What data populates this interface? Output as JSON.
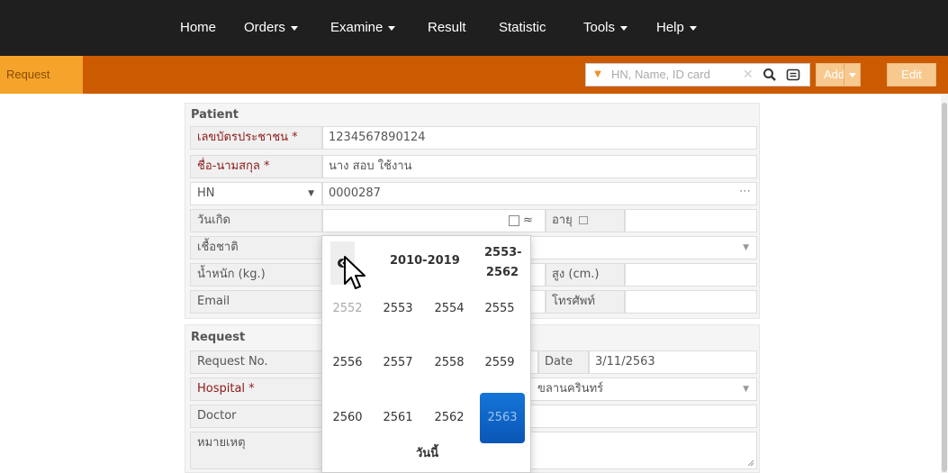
{
  "nav": {
    "items": [
      {
        "label": "Home"
      },
      {
        "label": "Orders"
      },
      {
        "label": "Examine"
      },
      {
        "label": "Result"
      },
      {
        "label": "Statistic"
      },
      {
        "label": "Tools"
      },
      {
        "label": "Help"
      }
    ]
  },
  "toolbar": {
    "tab_label": "Request",
    "search_placeholder": "HN, Name, ID card",
    "add_label": "Add",
    "edit_label": "Edit"
  },
  "patient": {
    "title": "Patient",
    "id_label": "เลขบัตรประชาชน *",
    "id_value": "1234567890124",
    "name_label": "ชื่อ-นามสกุล *",
    "name_value": "นาง สอบ ใช้งาน",
    "hn_label": "HN",
    "hn_value": "0000287",
    "dob_label": "วันเกิด",
    "approx_label": "≈",
    "age_label": "อายุ",
    "nation_label": "เชื้อชาติ",
    "weight_label": "น้ำหนัก (kg.)",
    "height_label": "สูง (cm.)",
    "email_label": "Email",
    "phone_label": "โทรศัพท์"
  },
  "request": {
    "title": "Request",
    "reqno_label": "Request No.",
    "date_label": "Date",
    "date_value": "3/11/2563",
    "hospital_label": "Hospital *",
    "hospital_value": "ขลานครินทร์",
    "doctor_label": "Doctor",
    "note_label": "หมายเหตุ"
  },
  "calendar": {
    "decade_label": "2010-2019",
    "century_line1": "2553-",
    "century_line2": "2562",
    "years": [
      "2552",
      "2553",
      "2554",
      "2555",
      "2556",
      "2557",
      "2558",
      "2559",
      "2560",
      "2561",
      "2562",
      "2563"
    ],
    "selected_year": "2563",
    "today_label": "วันนี้"
  },
  "colors": {
    "navbar": "#1f1f1f",
    "toolbar": "#cc5a00",
    "tab": "#f5a32a",
    "selected": "#0a56b5"
  }
}
